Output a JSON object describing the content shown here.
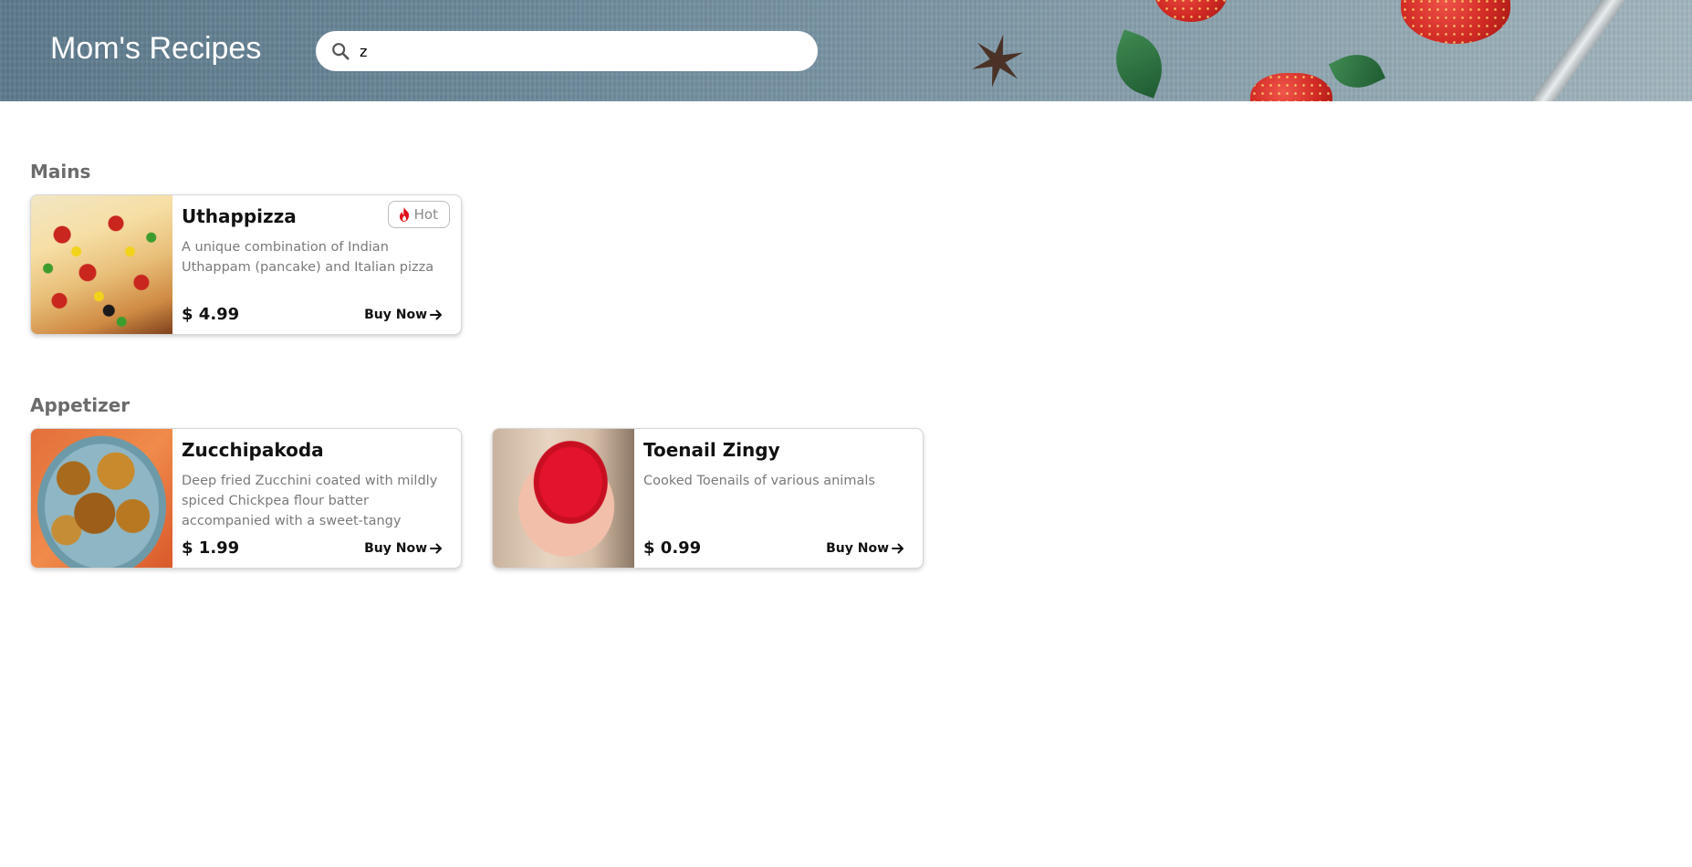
{
  "app": {
    "brand": "Mom's Recipes"
  },
  "search": {
    "value": "z",
    "icon": "search-icon"
  },
  "sections": [
    {
      "title": "Mains",
      "items": [
        {
          "name": "Uthappizza",
          "description": "A unique combination of Indian Uthappam (pancake) and Italian pizza",
          "price": "$ 4.99",
          "buy_label": "Buy Now",
          "badge": {
            "label": "Hot",
            "icon": "fire-icon",
            "color": "#e0101a"
          },
          "image": "pizza-image"
        }
      ]
    },
    {
      "title": "Appetizer",
      "items": [
        {
          "name": "Zucchipakoda",
          "description": "Deep fried Zucchini coated with mildly spiced Chickpea flour batter accompanied with a sweet-tangy",
          "price": "$ 1.99",
          "buy_label": "Buy Now",
          "image": "pakoda-image"
        },
        {
          "name": "Toenail Zingy",
          "description": "Cooked Toenails of various animals",
          "price": "$ 0.99",
          "buy_label": "Buy Now",
          "image": "toenail-image"
        }
      ]
    }
  ],
  "colors": {
    "header_bg": "#6e8b9c",
    "section_title": "#6b6b6b",
    "description": "#7a7a7a",
    "hot_icon": "#e0101a"
  }
}
